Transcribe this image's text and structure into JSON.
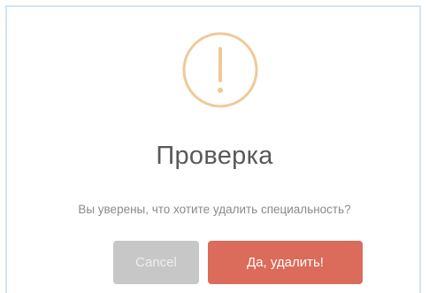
{
  "dialog": {
    "icon": "warning-exclamation-icon",
    "title": "Проверка",
    "message": "Вы уверены, что хотите удалить специальность?",
    "cancel_label": "Cancel",
    "confirm_label": "Да, удалить!"
  },
  "colors": {
    "icon": "#f0c998",
    "title_text": "#595959",
    "message_text": "#8a8a8a",
    "cancel_button": "#c7c7c7",
    "confirm_button": "#db6b5a",
    "frame_border": "#d2e4f3"
  }
}
